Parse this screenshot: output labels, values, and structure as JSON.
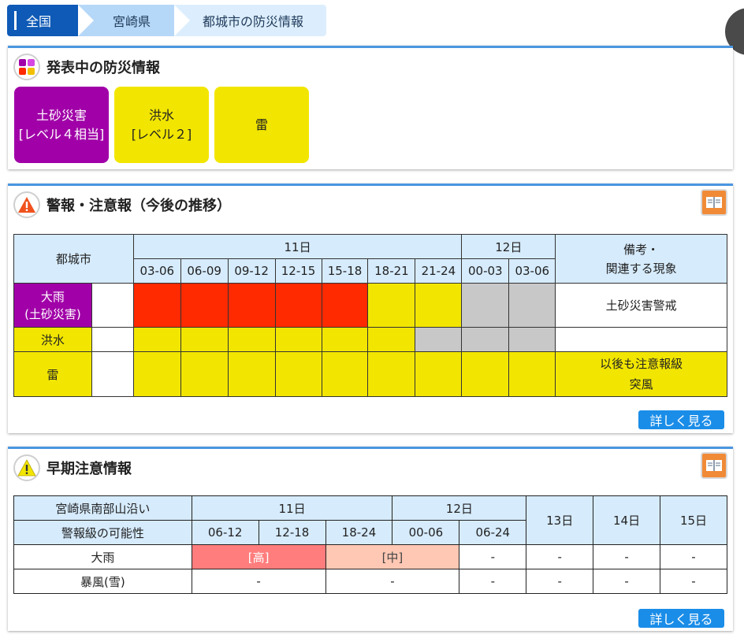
{
  "breadcrumb": {
    "home": "全国",
    "prefecture": "宮崎県",
    "city": "都城市の防災情報"
  },
  "current": {
    "title": "発表中の防災情報",
    "cards": [
      {
        "line1": "土砂災害",
        "line2": "[レベル４相当]",
        "color": "#a100a8",
        "text_color": "#ffffff"
      },
      {
        "line1": "洪水",
        "line2": "[レベル２]",
        "color": "#f2e600",
        "text_color": "#222222"
      },
      {
        "line1": "雷",
        "line2": "",
        "color": "#f2e600",
        "text_color": "#222222"
      }
    ]
  },
  "warnings": {
    "title": "警報・注意報（今後の推移）",
    "area": "都城市",
    "day1": "11日",
    "day2": "12日",
    "remarks_header": [
      "備考・",
      "関連する現象"
    ],
    "times": [
      "03-06",
      "06-09",
      "09-12",
      "12-15",
      "15-18",
      "18-21",
      "21-24",
      "00-03",
      "03-06"
    ],
    "rows": [
      {
        "name": [
          "大雨",
          "(土砂災害)"
        ],
        "cells": [
          "red",
          "red",
          "red",
          "red",
          "red",
          "yel",
          "yel",
          "gry",
          "gry"
        ],
        "remarks": [
          "土砂災害警戒"
        ]
      },
      {
        "name": [
          "洪水"
        ],
        "cells": [
          "yel",
          "yel",
          "yel",
          "yel",
          "yel",
          "yel",
          "gry",
          "gry",
          "gry"
        ],
        "remarks": [
          ""
        ]
      },
      {
        "name": [
          "雷"
        ],
        "cells": [
          "yel",
          "yel",
          "yel",
          "yel",
          "yel",
          "yel",
          "yel",
          "yel",
          "yel"
        ],
        "remarks": [
          "以後も注意報級",
          "突風"
        ]
      }
    ],
    "more": "詳しく見る"
  },
  "early": {
    "title": "早期注意情報",
    "region": "宮崎県南部山沿い",
    "subtitle": "警報級の可能性",
    "day1": "11日",
    "day2": "12日",
    "day3": "13日",
    "day4": "14日",
    "day5": "15日",
    "times": [
      "06-12",
      "12-18",
      "18-24",
      "00-06",
      "06-24"
    ],
    "rows": [
      {
        "name": "大雨",
        "high": "[高]",
        "mid": "[中]",
        "rest": [
          "-",
          "-",
          "-",
          "-"
        ]
      },
      {
        "name": "暴風(雪)",
        "a": "-",
        "b": "-",
        "rest": [
          "-",
          "-",
          "-",
          "-"
        ]
      }
    ],
    "more": "詳しく見る"
  },
  "colors": {
    "level4_purple": "#a100a8",
    "warning_red": "#ff2a00",
    "advisory_yellow": "#f2e600",
    "none_gray": "#c8c8c8",
    "high_pink": "#ff7d7d",
    "mid_pink": "#ffc8b4",
    "accent_blue": "#1a8de8"
  }
}
